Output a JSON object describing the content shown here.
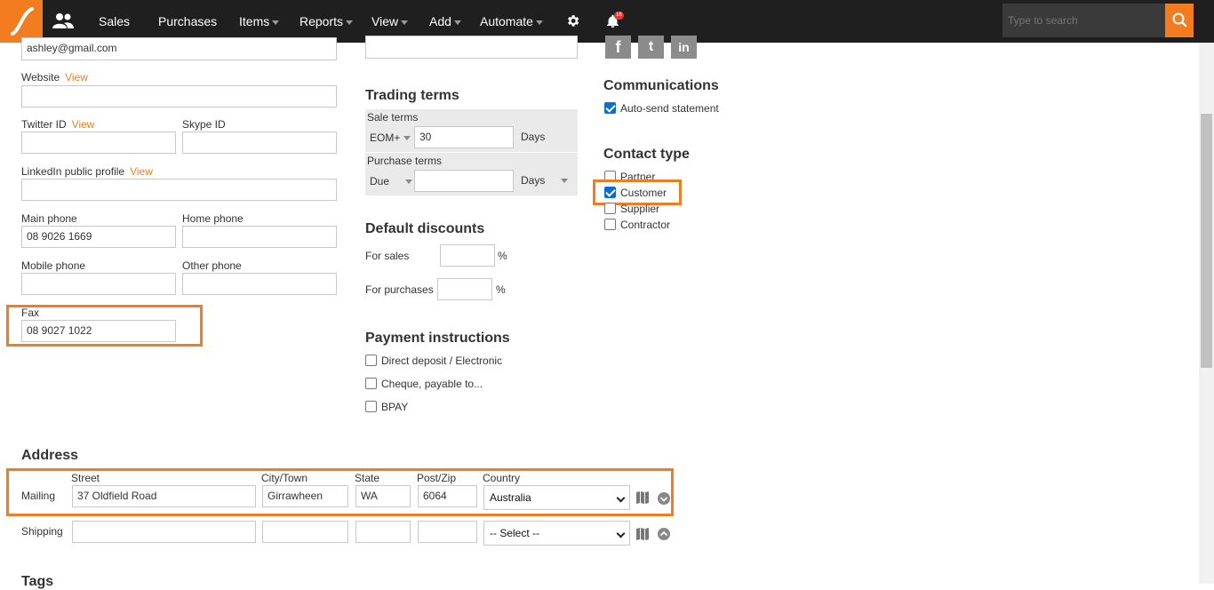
{
  "nav": {
    "sales": "Sales",
    "purchases": "Purchases",
    "items": "Items",
    "reports": "Reports",
    "view": "View",
    "add": "Add",
    "automate": "Automate",
    "notification_count": "16",
    "search_placeholder": "Type to search"
  },
  "contact": {
    "email_value": "ashley@gmail.com",
    "website_label": "Website",
    "view_link": "View",
    "twitter_label": "Twitter ID",
    "skype_label": "Skype ID",
    "linkedin_label": "LinkedIn public profile",
    "main_phone_label": "Main phone",
    "main_phone_value": "08 9026 1669",
    "home_phone_label": "Home phone",
    "mobile_phone_label": "Mobile phone",
    "other_phone_label": "Other phone",
    "fax_label": "Fax",
    "fax_value": "08 9027 1022"
  },
  "trading": {
    "title": "Trading terms",
    "sale_terms_label": "Sale terms",
    "sale_terms_type": "EOM+",
    "sale_terms_value": "30",
    "sale_terms_unit": "Days",
    "purchase_terms_label": "Purchase terms",
    "purchase_terms_type": "Due",
    "purchase_terms_value": "",
    "purchase_terms_unit": "Days"
  },
  "discounts": {
    "title": "Default discounts",
    "for_sales_label": "For sales",
    "for_purchases_label": "For purchases",
    "percent": "%"
  },
  "payment": {
    "title": "Payment instructions",
    "options": [
      "Direct deposit / Electronic",
      "Cheque, payable to...",
      "BPAY"
    ]
  },
  "social": {
    "facebook": "f",
    "twitter": "t",
    "linkedin": "in"
  },
  "communications": {
    "title": "Communications",
    "auto_send": "Auto-send statement"
  },
  "contact_type": {
    "title": "Contact type",
    "options": [
      {
        "label": "Partner",
        "checked": false
      },
      {
        "label": "Customer",
        "checked": true
      },
      {
        "label": "Supplier",
        "checked": false
      },
      {
        "label": "Contractor",
        "checked": false
      }
    ]
  },
  "address": {
    "title": "Address",
    "col_street": "Street",
    "col_city": "City/Town",
    "col_state": "State",
    "col_post": "Post/Zip",
    "col_country": "Country",
    "mailing": {
      "label": "Mailing",
      "street": "37 Oldfield Road",
      "city": "Girrawheen",
      "state": "WA",
      "post": "6064",
      "country": "Australia"
    },
    "shipping": {
      "label": "Shipping",
      "country": "-- Select --"
    }
  },
  "tags_title": "Tags",
  "colors": {
    "accent": "#f47c20",
    "nav_bg": "#1f1f1f",
    "check_blue": "#0a6ed1"
  }
}
